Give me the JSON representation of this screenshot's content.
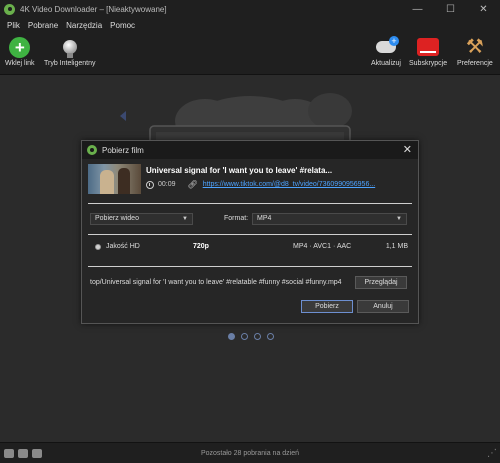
{
  "window": {
    "title": "4K Video Downloader – [Nieaktywowane]",
    "controls": {
      "minimize": "—",
      "maximize": "☐",
      "close": "✕"
    }
  },
  "menu": [
    "Plik",
    "Pobrane",
    "Narzędzia",
    "Pomoc"
  ],
  "toolbar": {
    "paste_link": "Wklej link",
    "smart_mode": "Tryb Inteligentny",
    "activate": "Aktualizuj",
    "subscriptions": "Subskrypcje",
    "preferences": "Preferencje"
  },
  "dialog": {
    "title": "Pobierz film",
    "close": "✕",
    "video": {
      "title": "Universal signal for 'I want you to leave' #relata...",
      "duration": "00:09",
      "url": "https://www.tiktok.com/@d8_tv/video/7360990956956..."
    },
    "download_type": {
      "value": "Pobierz wideo",
      "arrow": "▼"
    },
    "format": {
      "label": "Format:",
      "value": "MP4",
      "arrow": "▼"
    },
    "quality": {
      "name": "Jakość HD",
      "resolution": "720p",
      "codec": "MP4 · AVC1 · AAC",
      "size": "1,1 MB"
    },
    "path": "top/Universal signal for 'I want you to leave' #relatable #funny #social #funny.mp4",
    "browse_button": "Przeglądaj",
    "download_button": "Pobierz",
    "cancel_button": "Anuluj"
  },
  "pager": {
    "pages": 4,
    "active_index": 0
  },
  "status": {
    "text": "Pozostało 28 pobrania na dzień"
  },
  "colors": {
    "accent": "#4da3ff",
    "brand_green": "#3fb342",
    "background": "#2b2b2b"
  }
}
